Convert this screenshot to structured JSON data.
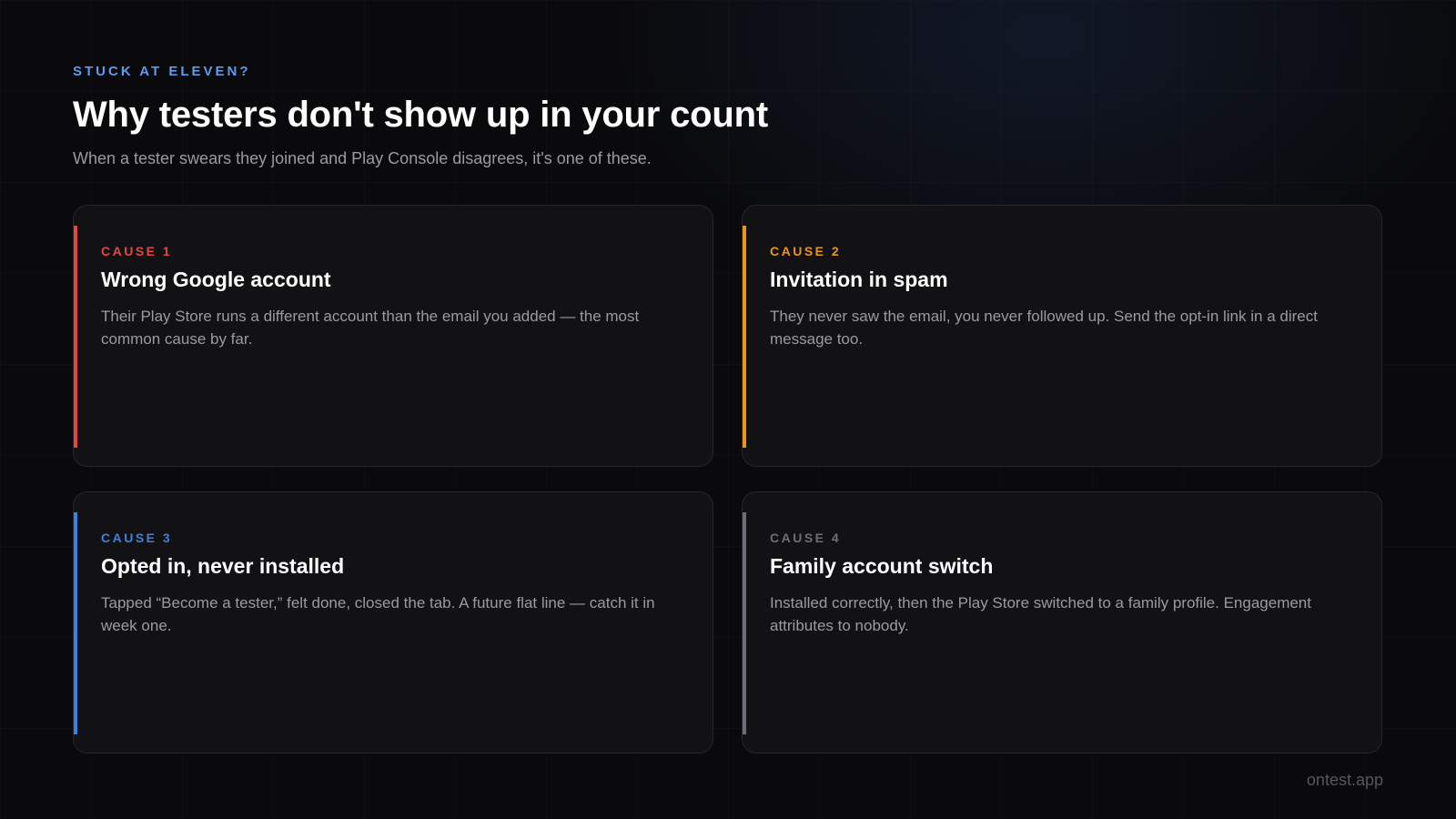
{
  "header": {
    "eyebrow": "STUCK AT ELEVEN?",
    "title": "Why testers don't show up in your count",
    "subtitle": "When a tester swears they joined and Play Console disagrees, it's one of these."
  },
  "cards": [
    {
      "label": "CAUSE 1",
      "title": "Wrong Google account",
      "description": "Their Play Store runs a different account than the email you added — the most common cause by far.",
      "accent": "#e04848"
    },
    {
      "label": "CAUSE 2",
      "title": "Invitation in spam",
      "description": "They never saw the email, you never followed up. Send the opt-in link in a direct message too.",
      "accent": "#e8961c"
    },
    {
      "label": "CAUSE 3",
      "title": "Opted in, never installed",
      "description": "Tapped “Become a tester,” felt done, closed the tab. A future flat line — catch it in week one.",
      "accent": "#3f7fe0"
    },
    {
      "label": "CAUSE 4",
      "title": "Family account switch",
      "description": "Installed correctly, then the Play Store switched to a family profile. Engagement attributes to nobody.",
      "accent": "#6e6e76"
    }
  ],
  "footer": {
    "brand": "ontest.app"
  },
  "colors": {
    "background": "#0a0a0c",
    "card": "#121215",
    "eyebrow": "#5b9bf0"
  }
}
